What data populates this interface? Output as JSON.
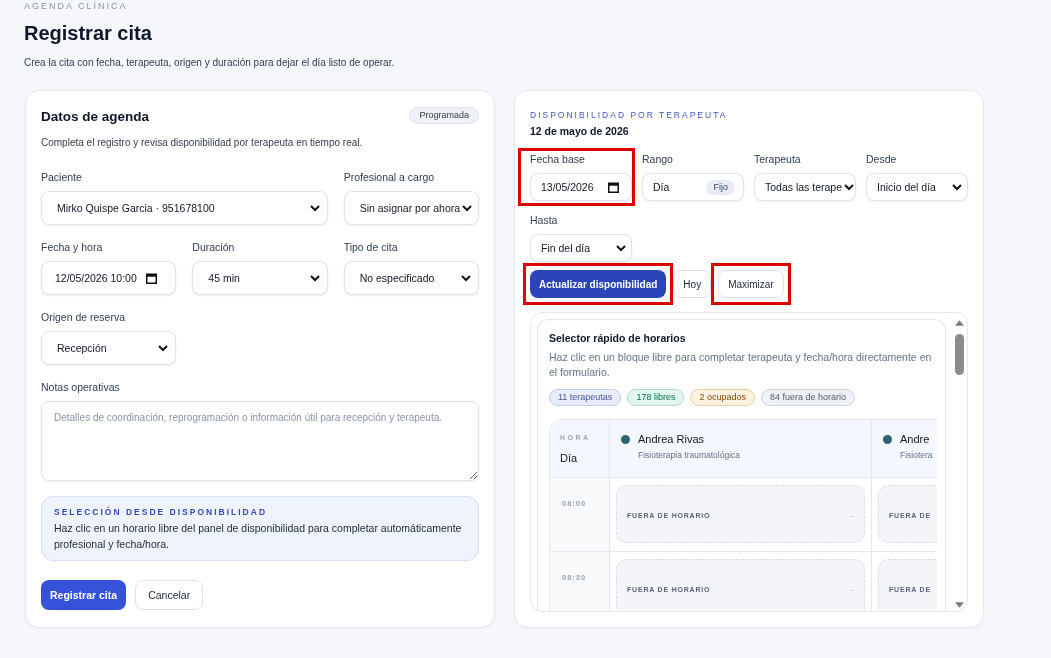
{
  "header": {
    "eyebrow": "AGENDA CLÍNICA",
    "title": "Registrar cita",
    "subtitle": "Crea la cita con fecha, terapeuta, origen y duración para dejar el día listo de operar."
  },
  "form": {
    "title": "Datos de agenda",
    "status_badge": "Programada",
    "description": "Completa el registro y revisa disponibilidad por terapeuta en tiempo real.",
    "fields": [
      {
        "kind": "select",
        "label": "Paciente",
        "value": "Mirko Quispe Garcia · 951678100"
      },
      {
        "kind": "select",
        "label": "Profesional a cargo",
        "value": "Sin asignar por ahora"
      },
      {
        "kind": "datetime",
        "label": "Fecha y hora",
        "value": "12/05/2026 10:00"
      },
      {
        "kind": "select",
        "label": "Duración",
        "value": "45 min"
      },
      {
        "kind": "select",
        "label": "Tipo de cita",
        "value": "No especificado"
      },
      {
        "kind": "select",
        "label": "Origen de reserva",
        "value": "Recepción"
      },
      {
        "kind": "textarea",
        "label": "Notas operativas",
        "placeholder": "Detalles de coordinación, reprogramación o información útil para recepción y terapeuta."
      }
    ],
    "info": {
      "title": "SELECCIÓN DESDE DISPONIBILIDAD",
      "text": "Haz clic en un horario libre del panel de disponibilidad para completar automáticamente profesional y fecha/hora."
    },
    "buttons": [
      {
        "kind": "primary",
        "label": "Registrar cita"
      },
      {
        "kind": "secondary",
        "label": "Cancelar"
      }
    ]
  },
  "availability": {
    "eyebrow": "DISPONIBILIDAD POR TERAPEUTA",
    "date": "12 de mayo de 2026",
    "filters": [
      {
        "kind": "date",
        "label": "Fecha base",
        "value": "13/05/2026",
        "highlighted": true
      },
      {
        "kind": "fixed",
        "label": "Rango",
        "value": "Día",
        "badge": "Fijo",
        "highlighted": false
      },
      {
        "kind": "select",
        "label": "Terapeuta",
        "value": "Todas las terape",
        "highlighted": false
      },
      {
        "kind": "select",
        "label": "Desde",
        "value": "Inicio del día",
        "highlighted": false
      },
      {
        "kind": "select",
        "label": "Hasta",
        "value": "Fin del día",
        "highlighted": false
      }
    ],
    "actions": [
      {
        "kind": "primary",
        "label": "Actualizar disponibilidad",
        "highlighted": true
      },
      {
        "kind": "secondary",
        "label": "Hoy",
        "highlighted": false
      },
      {
        "kind": "secondary",
        "label": "Maximizar",
        "highlighted": true
      }
    ],
    "quick_picker": {
      "title": "Selector rápido de horarios",
      "description": "Haz clic en un bloque libre para completar terapeuta y fecha/hora directamente en el formulario.",
      "chips": [
        {
          "label": "11 terapeutas",
          "color": "#e9edfb"
        },
        {
          "label": "178 libres",
          "color": "#e3f6ee"
        },
        {
          "label": "2 ocupados",
          "color": "#fff1e0"
        },
        {
          "label": "84 fuera de horario",
          "color": "#eef1f5"
        }
      ],
      "schedule": {
        "hour_heading": "HORA",
        "day_heading": "Día",
        "therapists": [
          {
            "name": "Andrea Rivas",
            "specialty": "Fisioterapia traumatológica",
            "color": "#2d6470"
          },
          {
            "name": "Andre",
            "specialty": "Fisiotera",
            "color": "#2d6470"
          }
        ],
        "rows": [
          {
            "time": "08:00",
            "slots": [
              {
                "kind": "off_hours",
                "label": "FUERA DE HORARIO",
                "detail": "-"
              },
              {
                "kind": "off_hours",
                "label": "FUERA DE"
              }
            ]
          },
          {
            "time": "08:30",
            "slots": [
              {
                "kind": "off_hours",
                "label": "FUERA DE HORARIO",
                "detail": "-"
              },
              {
                "kind": "off_hours",
                "label": "FUERA DE"
              }
            ]
          }
        ]
      }
    }
  }
}
